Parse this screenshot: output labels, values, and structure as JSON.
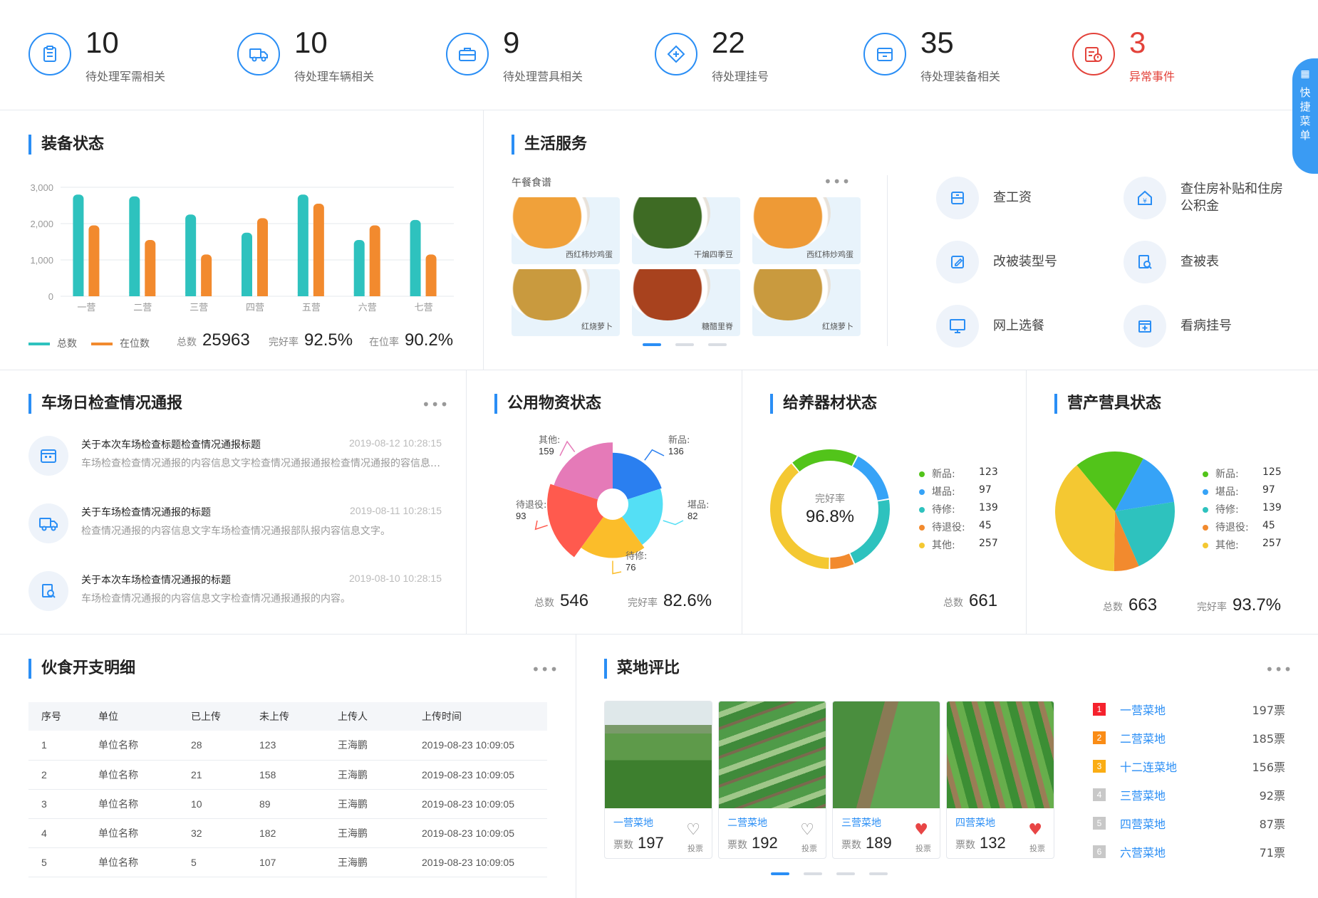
{
  "stats": [
    {
      "num": "10",
      "label": "待处理军需相关",
      "icon": "clipboard-icon"
    },
    {
      "num": "10",
      "label": "待处理车辆相关",
      "icon": "truck-icon"
    },
    {
      "num": "9",
      "label": "待处理营具相关",
      "icon": "toolbox-icon"
    },
    {
      "num": "22",
      "label": "待处理挂号",
      "icon": "medical-icon"
    },
    {
      "num": "35",
      "label": "待处理装备相关",
      "icon": "box-icon"
    },
    {
      "num": "3",
      "label": "异常事件",
      "icon": "alert-calendar-icon"
    }
  ],
  "quick_menu": "快捷菜单",
  "equipment": {
    "title": "装备状态",
    "legend_total": "总数",
    "legend_present": "在位数",
    "total_label": "总数",
    "total": "25963",
    "rate_label": "完好率",
    "rate": "92.5%",
    "present_label": "在位率",
    "present_rate": "90.2%"
  },
  "chart_data": [
    {
      "type": "bar",
      "title": "装备状态",
      "categories": [
        "一营",
        "二营",
        "三营",
        "四营",
        "五营",
        "六营",
        "七营"
      ],
      "series": [
        {
          "name": "总数",
          "values": [
            2800,
            2750,
            2250,
            1750,
            2800,
            1550,
            2100
          ]
        },
        {
          "name": "在位数",
          "values": [
            1950,
            1550,
            1150,
            2150,
            2550,
            1950,
            1150
          ]
        }
      ],
      "ylim": [
        0,
        3000
      ],
      "yticks": [
        "3,000",
        "2,000",
        "1,000",
        "0"
      ],
      "grid": true,
      "legend": "bottom-left",
      "colors": [
        "#2ec2be",
        "#f28a2e"
      ]
    },
    {
      "type": "pie",
      "title": "公用物资状态",
      "subtype": "rose",
      "slices": [
        {
          "name": "堪品",
          "value": 82,
          "color": "#2a7ff0"
        },
        {
          "name": "待修",
          "value": 76,
          "color": "#54dff5"
        },
        {
          "name": "待退役",
          "value": 93,
          "color": "#fbbd2a"
        },
        {
          "name": "其他",
          "value": 159,
          "color": "#ff5a4e"
        },
        {
          "name": "新品",
          "value": 136,
          "color": "#e57ab8"
        }
      ]
    },
    {
      "type": "pie",
      "title": "给养器材状态",
      "subtype": "donut",
      "slices": [
        {
          "name": "新品",
          "value": 123,
          "color": "#52c41a"
        },
        {
          "name": "堪品",
          "value": 97,
          "color": "#36a3f7"
        },
        {
          "name": "待修",
          "value": 139,
          "color": "#2ec2be"
        },
        {
          "name": "待退役",
          "value": 45,
          "color": "#f28a2e"
        },
        {
          "name": "其他",
          "value": 257,
          "color": "#f4c832"
        }
      ]
    },
    {
      "type": "pie",
      "title": "营产营具状态",
      "slices": [
        {
          "name": "新品",
          "value": 125,
          "color": "#52c41a"
        },
        {
          "name": "堪品",
          "value": 97,
          "color": "#36a3f7"
        },
        {
          "name": "待修",
          "value": 139,
          "color": "#2ec2be"
        },
        {
          "name": "待退役",
          "value": 45,
          "color": "#f28a2e"
        },
        {
          "name": "其他",
          "value": 257,
          "color": "#f4c832"
        }
      ]
    }
  ],
  "life": {
    "title": "生活服务",
    "lunch": "午餐食谱",
    "meals": [
      {
        "name": "西红柿炒鸡蛋",
        "color": "#f0a13a"
      },
      {
        "name": "干煸四季豆",
        "color": "#3e6b24"
      },
      {
        "name": "西红柿炒鸡蛋",
        "color": "#ee9a36"
      },
      {
        "name": "红烧萝卜",
        "color": "#c99a3e"
      },
      {
        "name": "糖醋里脊",
        "color": "#a8421e"
      },
      {
        "name": "红烧萝卜",
        "color": "#c99a3e"
      }
    ],
    "services": [
      {
        "label": "查工资",
        "icon": "wallet-icon"
      },
      {
        "label": "查住房补贴和住房公积金",
        "icon": "house-yuan-icon"
      },
      {
        "label": "改被装型号",
        "icon": "edit-icon"
      },
      {
        "label": "查被表",
        "icon": "search-doc-icon"
      },
      {
        "label": "网上选餐",
        "icon": "monitor-icon"
      },
      {
        "label": "看病挂号",
        "icon": "calendar-plus-icon"
      }
    ]
  },
  "inspection": {
    "title": "车场日检查情况通报",
    "items": [
      {
        "title": "关于本次车场检查标题检查情况通报标题",
        "time": "2019-08-12  10:28:15",
        "desc": "车场检查检查情况通报的内容信息文字检查情况通报通报检查情况通报的容信息文字",
        "icon": "calendar-icon"
      },
      {
        "title": "关于车场检查情况通报的标题",
        "time": "2019-08-11  10:28:15",
        "desc": "检查情况通报的内容信息文字车场检查情况通报部队报内容信息文字。",
        "icon": "truck-icon"
      },
      {
        "title": "关于本次车场检查情况通报的标题",
        "time": "2019-08-10  10:28:15",
        "desc": "车场检查情况通报的内容信息文字检查情况通报通报的内容。",
        "icon": "doc-search-icon"
      }
    ]
  },
  "public_goods": {
    "title": "公用物资状态",
    "total_label": "总数",
    "total": "546",
    "rate_label": "完好率",
    "rate": "82.6%",
    "labels": [
      {
        "name": "新品:",
        "value": "136"
      },
      {
        "name": "堪品:",
        "value": "82"
      },
      {
        "name": "待修:",
        "value": "76"
      },
      {
        "name": "待退役:",
        "value": "93"
      },
      {
        "name": "其他:",
        "value": "159"
      }
    ]
  },
  "supply": {
    "title": "给养器材状态",
    "center_label": "完好率",
    "center_value": "96.8%",
    "total_label": "总数",
    "total": "661",
    "legend": [
      {
        "name": "新品:",
        "value": "123"
      },
      {
        "name": "堪品:",
        "value": "97"
      },
      {
        "name": "待修:",
        "value": "139"
      },
      {
        "name": "待退役:",
        "value": "45"
      },
      {
        "name": "其他:",
        "value": "257"
      }
    ]
  },
  "camp": {
    "title": "营产营具状态",
    "total_label": "总数",
    "total": "663",
    "rate_label": "完好率",
    "rate": "93.7%",
    "legend": [
      {
        "name": "新品:",
        "value": "125"
      },
      {
        "name": "堪品:",
        "value": "97"
      },
      {
        "name": "待修:",
        "value": "139"
      },
      {
        "name": "待退役:",
        "value": "45"
      },
      {
        "name": "其他:",
        "value": "257"
      }
    ]
  },
  "mess": {
    "title": "伙食开支明细",
    "headers": [
      "序号",
      "单位",
      "已上传",
      "未上传",
      "上传人",
      "上传时间"
    ],
    "rows": [
      [
        "1",
        "单位名称",
        "28",
        "123",
        "王海鹏",
        "2019-08-23  10:09:05"
      ],
      [
        "2",
        "单位名称",
        "21",
        "158",
        "王海鹏",
        "2019-08-23  10:09:05"
      ],
      [
        "3",
        "单位名称",
        "10",
        "89",
        "王海鹏",
        "2019-08-23  10:09:05"
      ],
      [
        "4",
        "单位名称",
        "32",
        "182",
        "王海鹏",
        "2019-08-23  10:09:05"
      ],
      [
        "5",
        "单位名称",
        "5",
        "107",
        "王海鹏",
        "2019-08-23  10:09:05"
      ]
    ]
  },
  "farm": {
    "title": "菜地评比",
    "votes_label": "票数",
    "vote_btn": "投票",
    "cards": [
      {
        "name": "一营菜地",
        "votes": "197",
        "liked": false
      },
      {
        "name": "二营菜地",
        "votes": "192",
        "liked": false
      },
      {
        "name": "三营菜地",
        "votes": "189",
        "liked": true
      },
      {
        "name": "四营菜地",
        "votes": "132",
        "liked": true
      }
    ],
    "ranking": [
      {
        "no": "1",
        "name": "一营菜地",
        "votes": "197票",
        "color": "#f5222d"
      },
      {
        "no": "2",
        "name": "二营菜地",
        "votes": "185票",
        "color": "#fa8c16"
      },
      {
        "no": "3",
        "name": "十二连菜地",
        "votes": "156票",
        "color": "#faad14"
      },
      {
        "no": "4",
        "name": "三营菜地",
        "votes": "92票",
        "color": "#c8c8c8"
      },
      {
        "no": "5",
        "name": "四营菜地",
        "votes": "87票",
        "color": "#c8c8c8"
      },
      {
        "no": "6",
        "name": "六营菜地",
        "votes": "71票",
        "color": "#c8c8c8"
      }
    ]
  }
}
